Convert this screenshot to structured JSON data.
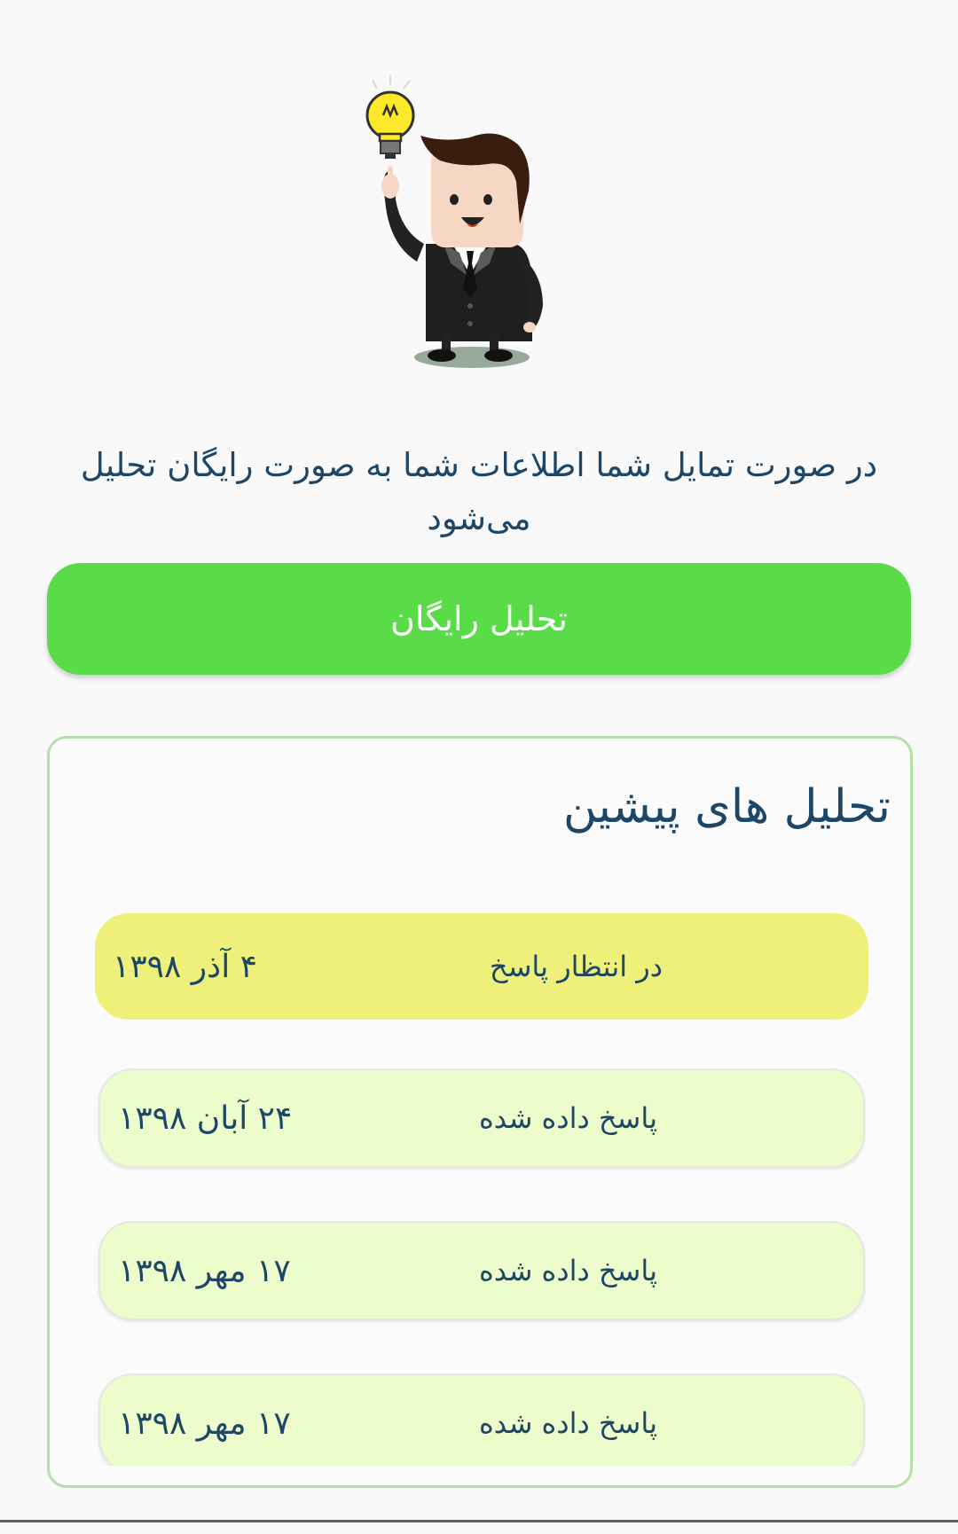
{
  "intro": {
    "text": "در صورت تمایل شما اطلاعات شما به صورت رایگان تحلیل می‌شود"
  },
  "free_analysis_button": {
    "label": "تحلیل رایگان",
    "color": "#59dc48"
  },
  "history": {
    "title": "تحلیل های پیشین",
    "items": [
      {
        "status": "در انتظار پاسخ",
        "date": "۴ آذر ۱۳۹۸",
        "state": "pending"
      },
      {
        "status": "پاسخ داده شده",
        "date": "۲۴ آبان ۱۳۹۸",
        "state": "answered"
      },
      {
        "status": "پاسخ داده شده",
        "date": "۱۷ مهر ۱۳۹۸",
        "state": "answered"
      },
      {
        "status": "پاسخ داده شده",
        "date": "۱۷ مهر ۱۳۹۸",
        "state": "answered"
      }
    ]
  },
  "colors": {
    "text": "#1e4666",
    "pending_bg": "#eff07a",
    "answered_bg": "#ecfccb",
    "card_border": "#b3e0a8"
  },
  "illustration": {
    "icon": "businessman-idea-lightbulb-illustration"
  }
}
